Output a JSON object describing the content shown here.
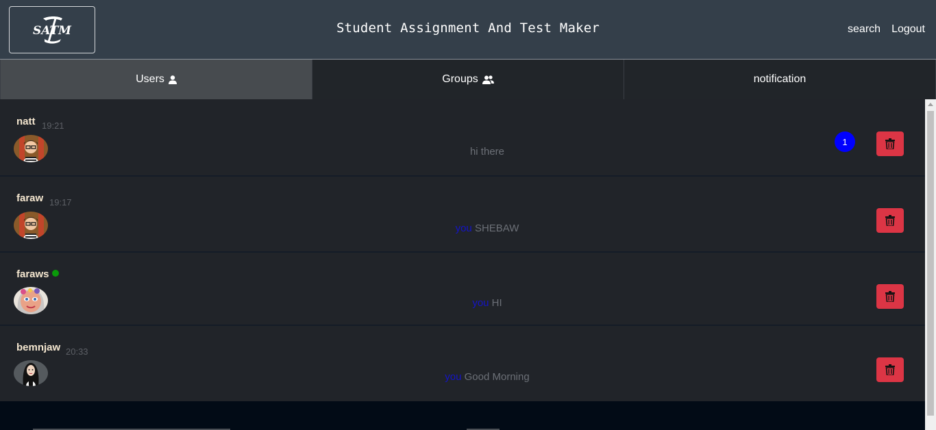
{
  "header": {
    "logo_text": "SATM",
    "title": "Student Assignment And Test Maker",
    "links": {
      "search": "search",
      "logout": "Logout"
    }
  },
  "tabs": [
    {
      "label": "Users",
      "icon": "user-icon",
      "active": true
    },
    {
      "label": "Groups",
      "icon": "users-group-icon",
      "active": false
    },
    {
      "label": "notification",
      "icon": "",
      "active": false
    }
  ],
  "conversations": [
    {
      "name": "natt",
      "time": "19:21",
      "online": false,
      "you_prefix": "",
      "message": "hi there",
      "unread": "1",
      "avatar": "avatar-boy-glasses"
    },
    {
      "name": "faraw",
      "time": "19:17",
      "online": false,
      "you_prefix": "you",
      "message": "SHEBAW",
      "unread": "",
      "avatar": "avatar-boy-glasses"
    },
    {
      "name": "faraws",
      "time": "",
      "online": true,
      "you_prefix": "you",
      "message": "HI",
      "unread": "",
      "avatar": "avatar-girl-flower"
    },
    {
      "name": "bemnjaw",
      "time": "20:33",
      "online": false,
      "you_prefix": "you",
      "message": "Good Morning",
      "unread": "",
      "avatar": "avatar-woman-dark"
    }
  ],
  "colors": {
    "header_bg": "#343f4a",
    "tab_bg": "#212529",
    "tab_active_bg": "#474b4f",
    "row_bg": "#212429",
    "name": "#f4e6cf",
    "you": "#1414c8",
    "badge": "#0000ff",
    "delete": "#dc3545",
    "online": "#0a9a0a"
  }
}
